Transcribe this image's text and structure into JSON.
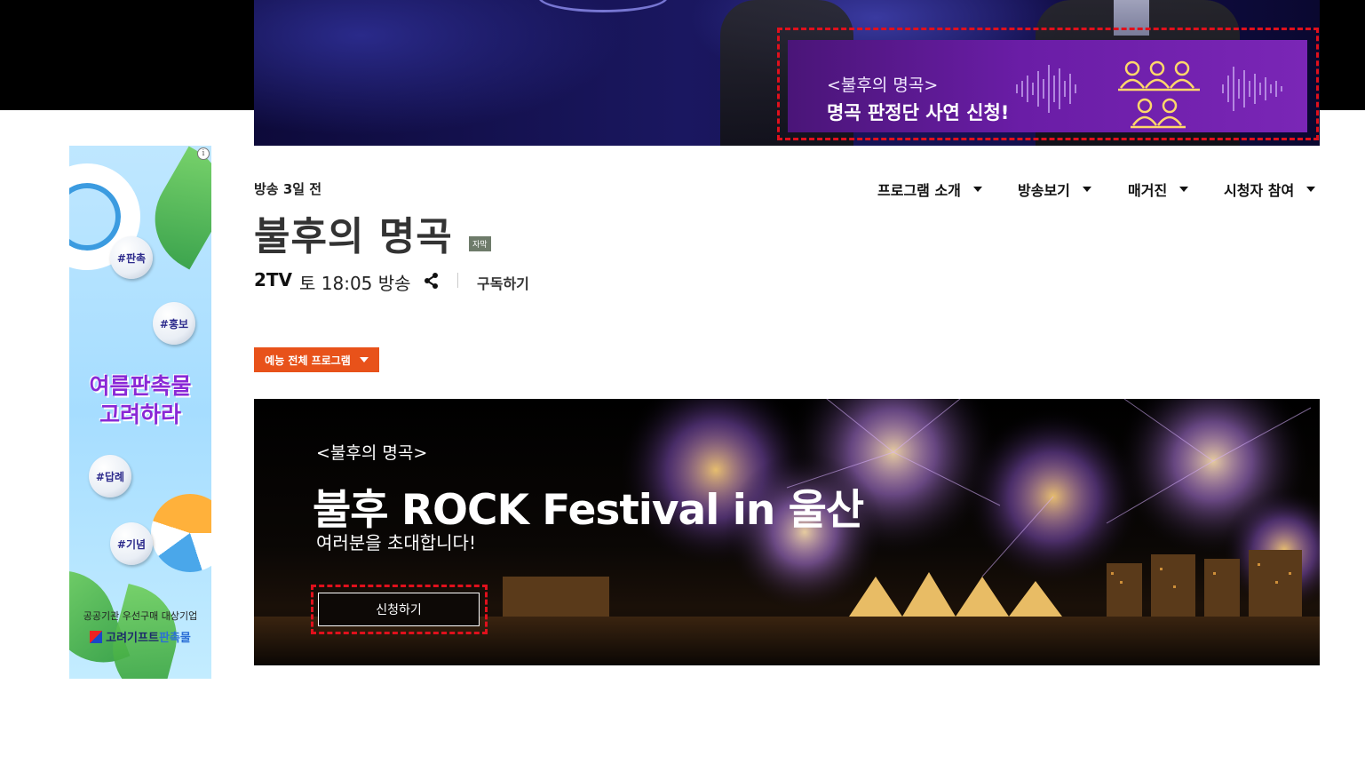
{
  "hero": {
    "apply_banner": {
      "subtitle": "<불후의 명곡>",
      "title": "명곡 판정단 사연 신청!",
      "icon": "judges-icon"
    }
  },
  "side_ad": {
    "info_icon": "info-icon",
    "tags": [
      "#판촉",
      "#홍보",
      "#답례",
      "#기념"
    ],
    "headline": [
      "여름판촉물",
      "고려하라"
    ],
    "footer_line1": "공공기관 우선구매 대상기업",
    "brand_main": "고려기프트",
    "brand_highlight": "판촉물"
  },
  "program": {
    "aired_ago": "방송 3일 전",
    "title": "불후의 명곡",
    "cc_badge": "자막",
    "channel": "2TV",
    "schedule": "토 18:05 방송",
    "share_icon": "share-icon",
    "subscribe": "구독하기"
  },
  "nav": {
    "items": [
      {
        "label": "프로그램 소개"
      },
      {
        "label": "방송보기"
      },
      {
        "label": "매거진"
      },
      {
        "label": "시청자 참여"
      }
    ]
  },
  "genre_dropdown": {
    "label": "예능 전체 프로그램"
  },
  "festival_banner": {
    "subtitle": "<불후의 명곡>",
    "title": "불후 ROCK Festival in 울산",
    "description": "여러분을 초대합니다!",
    "button": "신청하기"
  },
  "colors": {
    "accent_orange": "#e8521a",
    "banner_purple": "#6a1da6",
    "highlight_red": "#e0101c",
    "ad_purple": "#8a28d6"
  }
}
